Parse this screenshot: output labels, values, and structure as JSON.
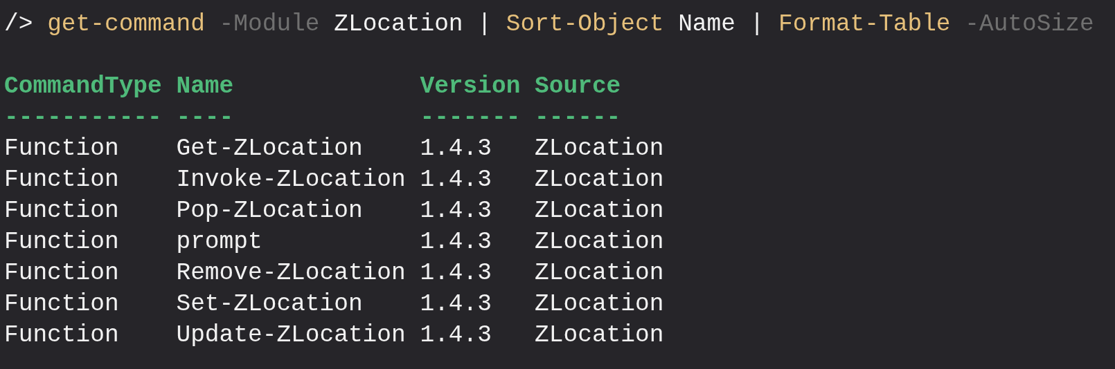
{
  "command_line": [
    {
      "kind": "prompt",
      "text": "/>"
    },
    {
      "kind": "command",
      "text": "get-command"
    },
    {
      "kind": "parameter",
      "text": "-Module"
    },
    {
      "kind": "argument",
      "text": "ZLocation"
    },
    {
      "kind": "operator",
      "text": "|"
    },
    {
      "kind": "command",
      "text": "Sort-Object"
    },
    {
      "kind": "argument",
      "text": "Name"
    },
    {
      "kind": "operator",
      "text": "|"
    },
    {
      "kind": "command",
      "text": "Format-Table"
    },
    {
      "kind": "parameter",
      "text": "-AutoSize"
    }
  ],
  "table": {
    "columns": [
      {
        "header": "CommandType",
        "underline": "-----------"
      },
      {
        "header": "Name",
        "underline": "----"
      },
      {
        "header": "Version",
        "underline": "-------"
      },
      {
        "header": "Source",
        "underline": "------"
      }
    ],
    "rows": [
      [
        "Function",
        "Get-ZLocation",
        "1.4.3",
        "ZLocation"
      ],
      [
        "Function",
        "Invoke-ZLocation",
        "1.4.3",
        "ZLocation"
      ],
      [
        "Function",
        "Pop-ZLocation",
        "1.4.3",
        "ZLocation"
      ],
      [
        "Function",
        "prompt",
        "1.4.3",
        "ZLocation"
      ],
      [
        "Function",
        "Remove-ZLocation",
        "1.4.3",
        "ZLocation"
      ],
      [
        "Function",
        "Set-ZLocation",
        "1.4.3",
        "ZLocation"
      ],
      [
        "Function",
        "Update-ZLocation",
        "1.4.3",
        "ZLocation"
      ]
    ]
  }
}
